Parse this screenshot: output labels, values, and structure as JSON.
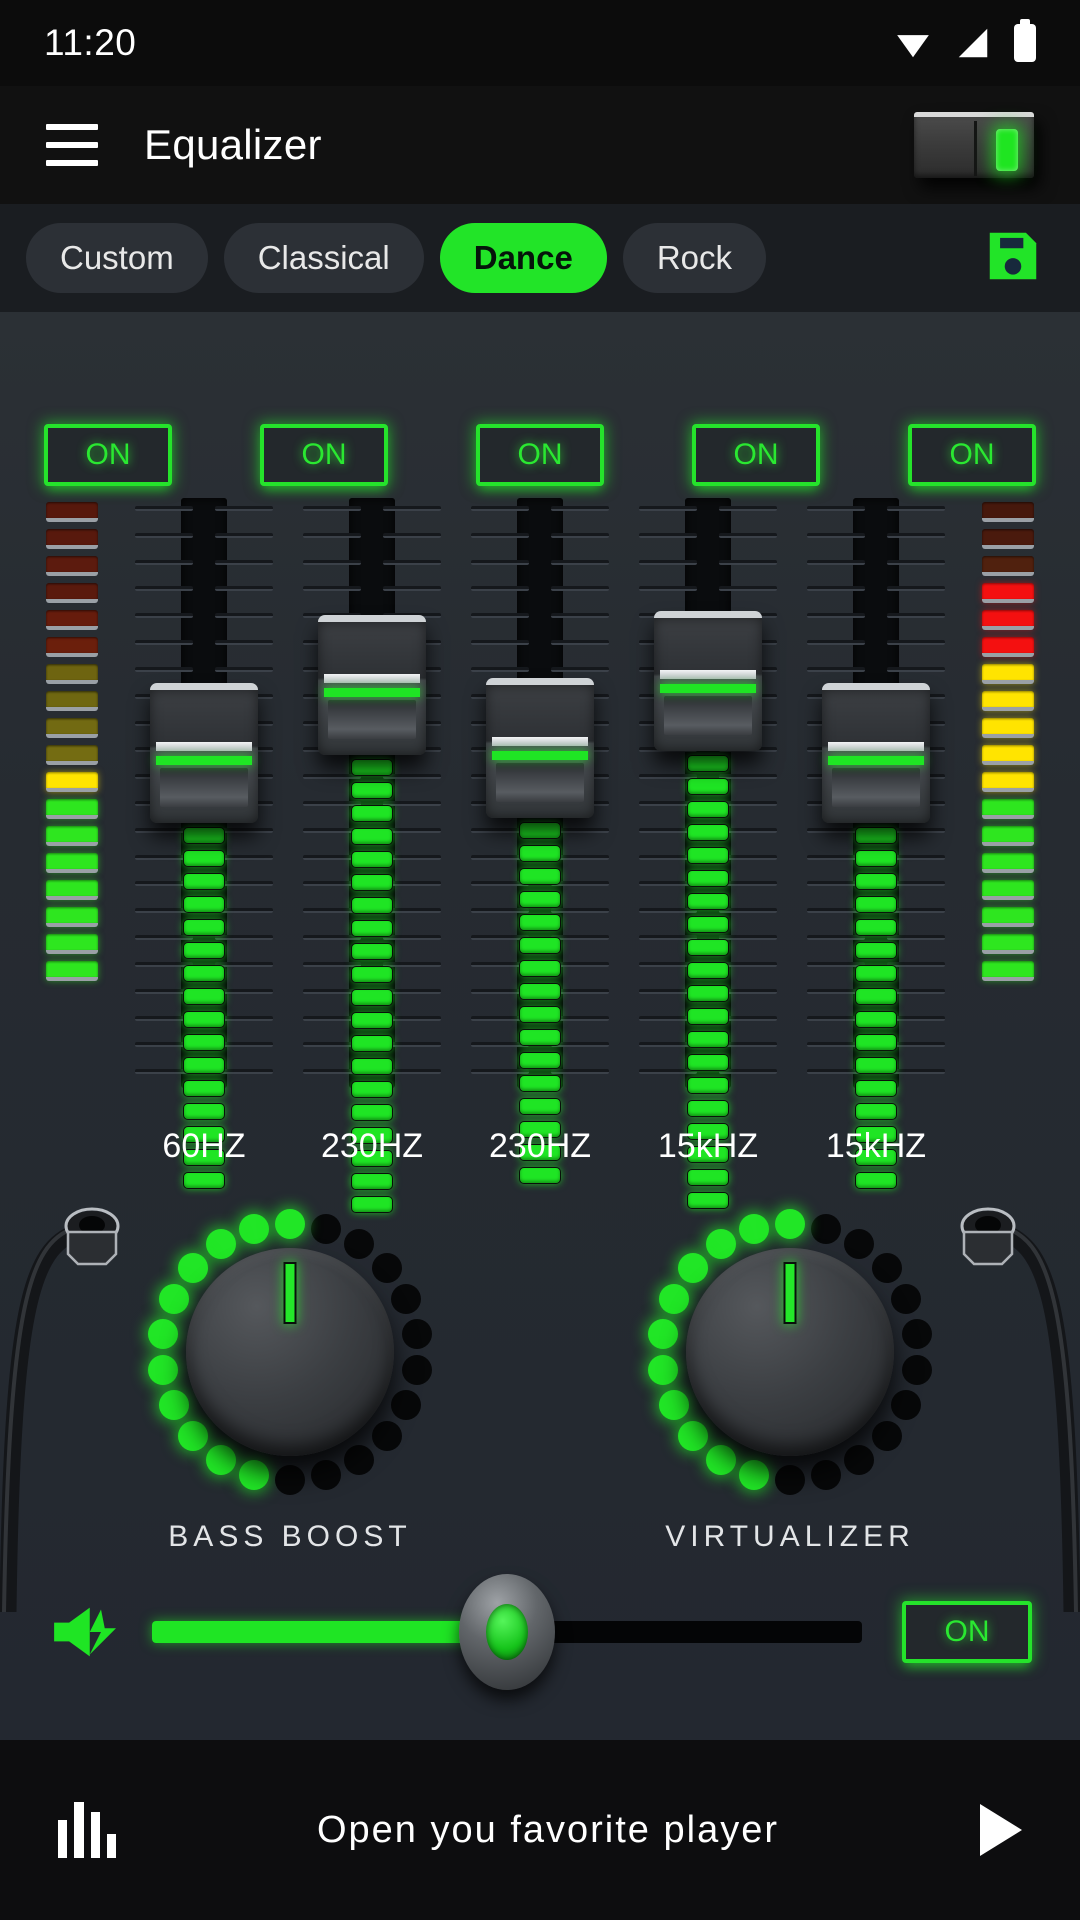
{
  "status_bar": {
    "time": "11:20",
    "icons": [
      "wifi-icon",
      "signal-icon",
      "battery-icon"
    ]
  },
  "app_bar": {
    "menu_icon": "hamburger-menu-icon",
    "title": "Equalizer",
    "power_switch": {
      "name": "power-rocker-switch",
      "state": "on",
      "led_color": "#1fe521"
    }
  },
  "presets": {
    "items": [
      {
        "label": "Custom",
        "active": false
      },
      {
        "label": "Classical",
        "active": false
      },
      {
        "label": "Dance",
        "active": true
      },
      {
        "label": "Rock",
        "active": false
      }
    ],
    "save_icon": "save-floppy-icon",
    "active_color": "#22e428",
    "inactive_bg": "#2c3036"
  },
  "equalizer": {
    "bands": [
      {
        "freq": "60HZ",
        "on_label": "ON",
        "thumb_pct": 41,
        "led_count": 16
      },
      {
        "freq": "230HZ",
        "on_label": "ON",
        "thumb_pct": 26,
        "led_count": 20
      },
      {
        "freq": "230HZ",
        "on_label": "ON",
        "thumb_pct": 40,
        "led_count": 16
      },
      {
        "freq": "15kHZ",
        "on_label": "ON",
        "thumb_pct": 25,
        "led_count": 20
      },
      {
        "freq": "15kHZ",
        "on_label": "ON",
        "thumb_pct": 41,
        "led_count": 16
      }
    ],
    "tick_count": 22
  },
  "vu_meters": {
    "segment_count": 18,
    "left": {
      "name": "vu-meter-left",
      "colors": [
        "#57180c",
        "#58190d",
        "#5c1b0e",
        "#5a1a0d",
        "#661c0c",
        "#6b1f0c",
        "#6e6410",
        "#6f6711",
        "#726a12",
        "#746c12",
        "#ffe400",
        "#2ee61f",
        "#2ee61f",
        "#2ee61f",
        "#2ee61f",
        "#2ee61f",
        "#2ee61f",
        "#2ee61f"
      ]
    },
    "right": {
      "name": "vu-meter-right",
      "colors": [
        "#46180c",
        "#4a1a0d",
        "#50210e",
        "#f41010",
        "#f41010",
        "#f41010",
        "#ffe400",
        "#ffe400",
        "#ffe400",
        "#ffe400",
        "#ffe400",
        "#2ee61f",
        "#2ee61f",
        "#2ee61f",
        "#2ee61f",
        "#2ee61f",
        "#2ee61f",
        "#2ee61f"
      ]
    }
  },
  "knobs": [
    {
      "name": "bass-boost-knob",
      "label": "BASS BOOST",
      "dots_total": 22,
      "dots_lit": 11,
      "indicator_angle": 0
    },
    {
      "name": "virtualizer-knob",
      "label": "VIRTUALIZER",
      "dots_total": 22,
      "dots_lit": 11,
      "indicator_angle": 0
    }
  ],
  "volume": {
    "speaker_icon": "volume-boost-icon",
    "fill_pct": 50,
    "on_label": "ON",
    "track_color": "#1fe524"
  },
  "bottom_bar": {
    "eq_icon": "equalizer-bars-icon",
    "text": "Open you favorite player",
    "play_icon": "play-icon"
  }
}
